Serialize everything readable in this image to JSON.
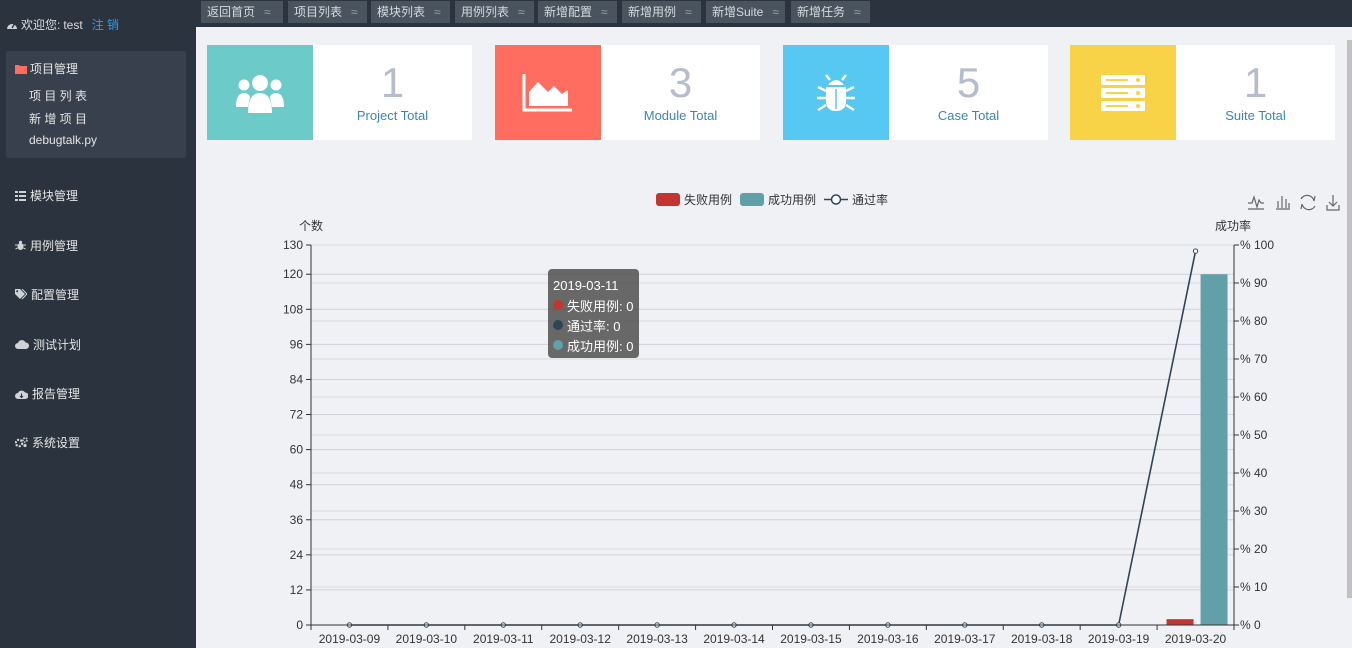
{
  "sidebar": {
    "welcome_prefix": "欢迎您:",
    "username": "test",
    "logout": "注 销",
    "panel_title": "项目管理",
    "panel_items": [
      "项 目 列 表",
      "新 增 项 目",
      "debugtalk.py"
    ],
    "nav": [
      "模块管理",
      "用例管理",
      "配置管理",
      "测试计划",
      "报告管理",
      "系统设置"
    ]
  },
  "tabs": [
    "返回首页",
    "项目列表",
    "模块列表",
    "用例列表",
    "新增配置",
    "新增用例",
    "新增Suite",
    "新增任务"
  ],
  "tab_tilde": "≈",
  "cards": [
    {
      "value": "1",
      "label": "Project Total",
      "color": "#6ccac9"
    },
    {
      "value": "3",
      "label": "Module Total",
      "color": "#ff6c60"
    },
    {
      "value": "5",
      "label": "Case Total",
      "color": "#57c8f2"
    },
    {
      "value": "1",
      "label": "Suite Total",
      "color": "#f8d347"
    }
  ],
  "legend": [
    "失败用例",
    "成功用例",
    "通过率"
  ],
  "tooltip": {
    "date": "2019-03-11",
    "rows": [
      {
        "label": "失败用例: 0",
        "color": "#c23531"
      },
      {
        "label": "通过率: 0",
        "color": "#2f4554"
      },
      {
        "label": "成功用例: 0",
        "color": "#61a0a8"
      }
    ]
  },
  "chart_data": {
    "type": "bar",
    "ylabel": "个数",
    "y2label": "成功率",
    "ylim": [
      0,
      130
    ],
    "y2lim": [
      0,
      100
    ],
    "yticks": [
      "0",
      "12",
      "24",
      "36",
      "48",
      "60",
      "72",
      "84",
      "96",
      "108",
      "120",
      "130"
    ],
    "y2ticks": [
      "% 0",
      "% 10",
      "% 20",
      "% 30",
      "% 40",
      "% 50",
      "% 60",
      "% 70",
      "% 80",
      "% 90",
      "% 100"
    ],
    "categories": [
      "2019-03-09",
      "2019-03-10",
      "2019-03-11",
      "2019-03-12",
      "2019-03-13",
      "2019-03-14",
      "2019-03-15",
      "2019-03-16",
      "2019-03-17",
      "2019-03-18",
      "2019-03-19",
      "2019-03-20"
    ],
    "series": [
      {
        "name": "失败用例",
        "type": "bar",
        "color": "#c23531",
        "values": [
          0,
          0,
          0,
          0,
          0,
          0,
          0,
          0,
          0,
          0,
          0,
          2
        ]
      },
      {
        "name": "成功用例",
        "type": "bar",
        "color": "#61a0a8",
        "values": [
          0,
          0,
          0,
          0,
          0,
          0,
          0,
          0,
          0,
          0,
          0,
          120
        ]
      },
      {
        "name": "通过率",
        "type": "line",
        "color": "#2f4554",
        "values": [
          0,
          0,
          0,
          0,
          0,
          0,
          0,
          0,
          0,
          0,
          0,
          98.4
        ]
      }
    ]
  }
}
